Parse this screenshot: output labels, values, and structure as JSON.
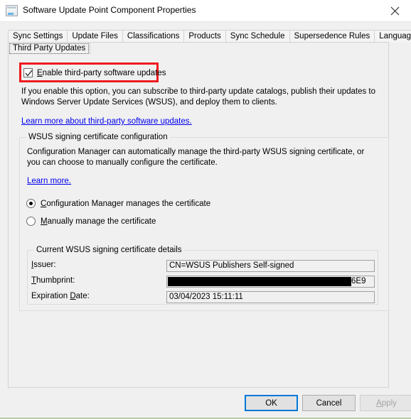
{
  "window": {
    "title": "Software Update Point Component Properties",
    "icon": "properties-window-icon",
    "close_label": "✕"
  },
  "tabs": {
    "row1": [
      {
        "label": "Sync Settings",
        "selected": false
      },
      {
        "label": "Update Files",
        "selected": false
      },
      {
        "label": "Classifications",
        "selected": false
      },
      {
        "label": "Products",
        "selected": false
      },
      {
        "label": "Sync Schedule",
        "selected": false
      },
      {
        "label": "Supersedence Rules",
        "selected": false
      },
      {
        "label": "Languages",
        "selected": false
      }
    ],
    "row2": [
      {
        "label": "Third Party Updates",
        "selected": true
      }
    ]
  },
  "main": {
    "enable_checkbox": {
      "accelerator": "E",
      "label_rest": "nable third-party software updates",
      "checked": true,
      "highlight_color": "#ee1b20"
    },
    "description": "If you enable this option, you can subscribe to third-party update catalogs, publish their updates to Windows Server Update Services (WSUS), and deploy them to clients.",
    "learn_more_top": "Learn more about third-party software updates.",
    "wsus_group": {
      "title": "WSUS signing certificate configuration",
      "description": "Configuration Manager can automatically manage the third-party WSUS signing certificate, or you can choose to manually configure the certificate.",
      "learn_more": "Learn more.",
      "radios": [
        {
          "accelerator": "C",
          "label_rest": "onfiguration Manager manages the certificate",
          "checked": true
        },
        {
          "accelerator": "M",
          "label_rest": "anually manage the certificate",
          "checked": false
        }
      ],
      "cert_details": {
        "title": "Current WSUS signing certificate details",
        "fields": [
          {
            "label_pre": "",
            "accelerator": "I",
            "label_post": "ssuer:",
            "value": "CN=WSUS Publishers Self-signed",
            "redacted": false
          },
          {
            "label_pre": "",
            "accelerator": "T",
            "label_post": "humbprint:",
            "value": "",
            "redacted": true,
            "redacted_tail": "6E9"
          },
          {
            "label_pre": "Expiration ",
            "accelerator": "D",
            "label_post": "ate:",
            "value": "03/04/2023 15:11:11",
            "redacted": false
          }
        ]
      }
    }
  },
  "footer": {
    "ok": "OK",
    "cancel": "Cancel",
    "apply": "Apply",
    "apply_accelerator": "A"
  },
  "colors": {
    "accent": "#0078d7",
    "highlight": "#ee1b20",
    "link": "#0000ee",
    "window_bg": "#f0f0f0"
  }
}
